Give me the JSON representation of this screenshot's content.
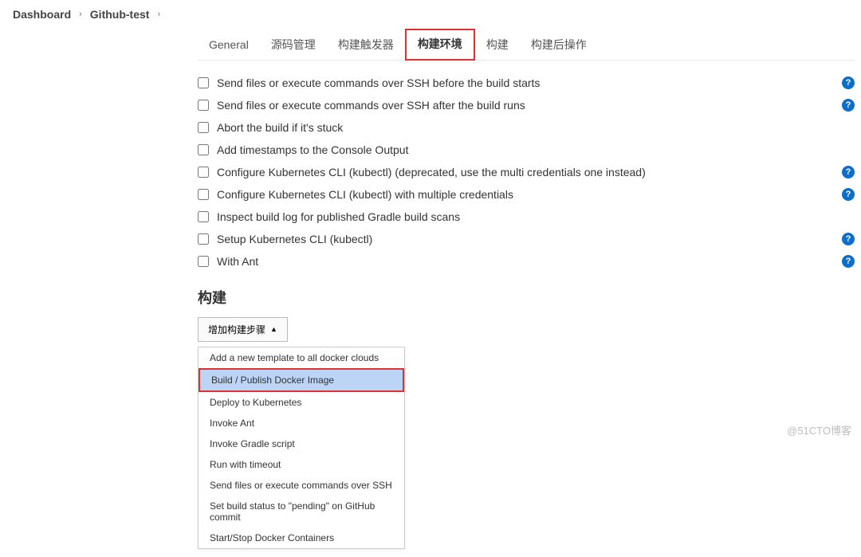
{
  "breadcrumb": {
    "root": "Dashboard",
    "project": "Github-test"
  },
  "tabs": {
    "general": "General",
    "scm": "源码管理",
    "triggers": "构建触发器",
    "env": "构建环境",
    "build": "构建",
    "post": "构建后操作"
  },
  "env_options": {
    "ssh_before": "Send files or execute commands over SSH before the build starts",
    "ssh_after": "Send files or execute commands over SSH after the build runs",
    "abort_stuck": "Abort the build if it's stuck",
    "timestamps": "Add timestamps to the Console Output",
    "k8s_cli_dep": "Configure Kubernetes CLI (kubectl) (deprecated, use the multi credentials one instead)",
    "k8s_cli_multi": "Configure Kubernetes CLI (kubectl) with multiple credentials",
    "gradle_scans": "Inspect build log for published Gradle build scans",
    "k8s_setup": "Setup Kubernetes CLI (kubectl)",
    "with_ant": "With Ant"
  },
  "build": {
    "heading": "构建",
    "add_step_label": "增加构建步骤",
    "steps": {
      "add_template": "Add a new template to all docker clouds",
      "build_publish_docker": "Build / Publish Docker Image",
      "deploy_k8s": "Deploy to Kubernetes",
      "invoke_ant": "Invoke Ant",
      "invoke_gradle": "Invoke Gradle script",
      "run_timeout": "Run with timeout",
      "ssh_send": "Send files or execute commands over SSH",
      "set_pending": "Set build status to \"pending\" on GitHub commit",
      "start_stop_docker": "Start/Stop Docker Containers"
    }
  },
  "watermark": "@51CTO博客"
}
